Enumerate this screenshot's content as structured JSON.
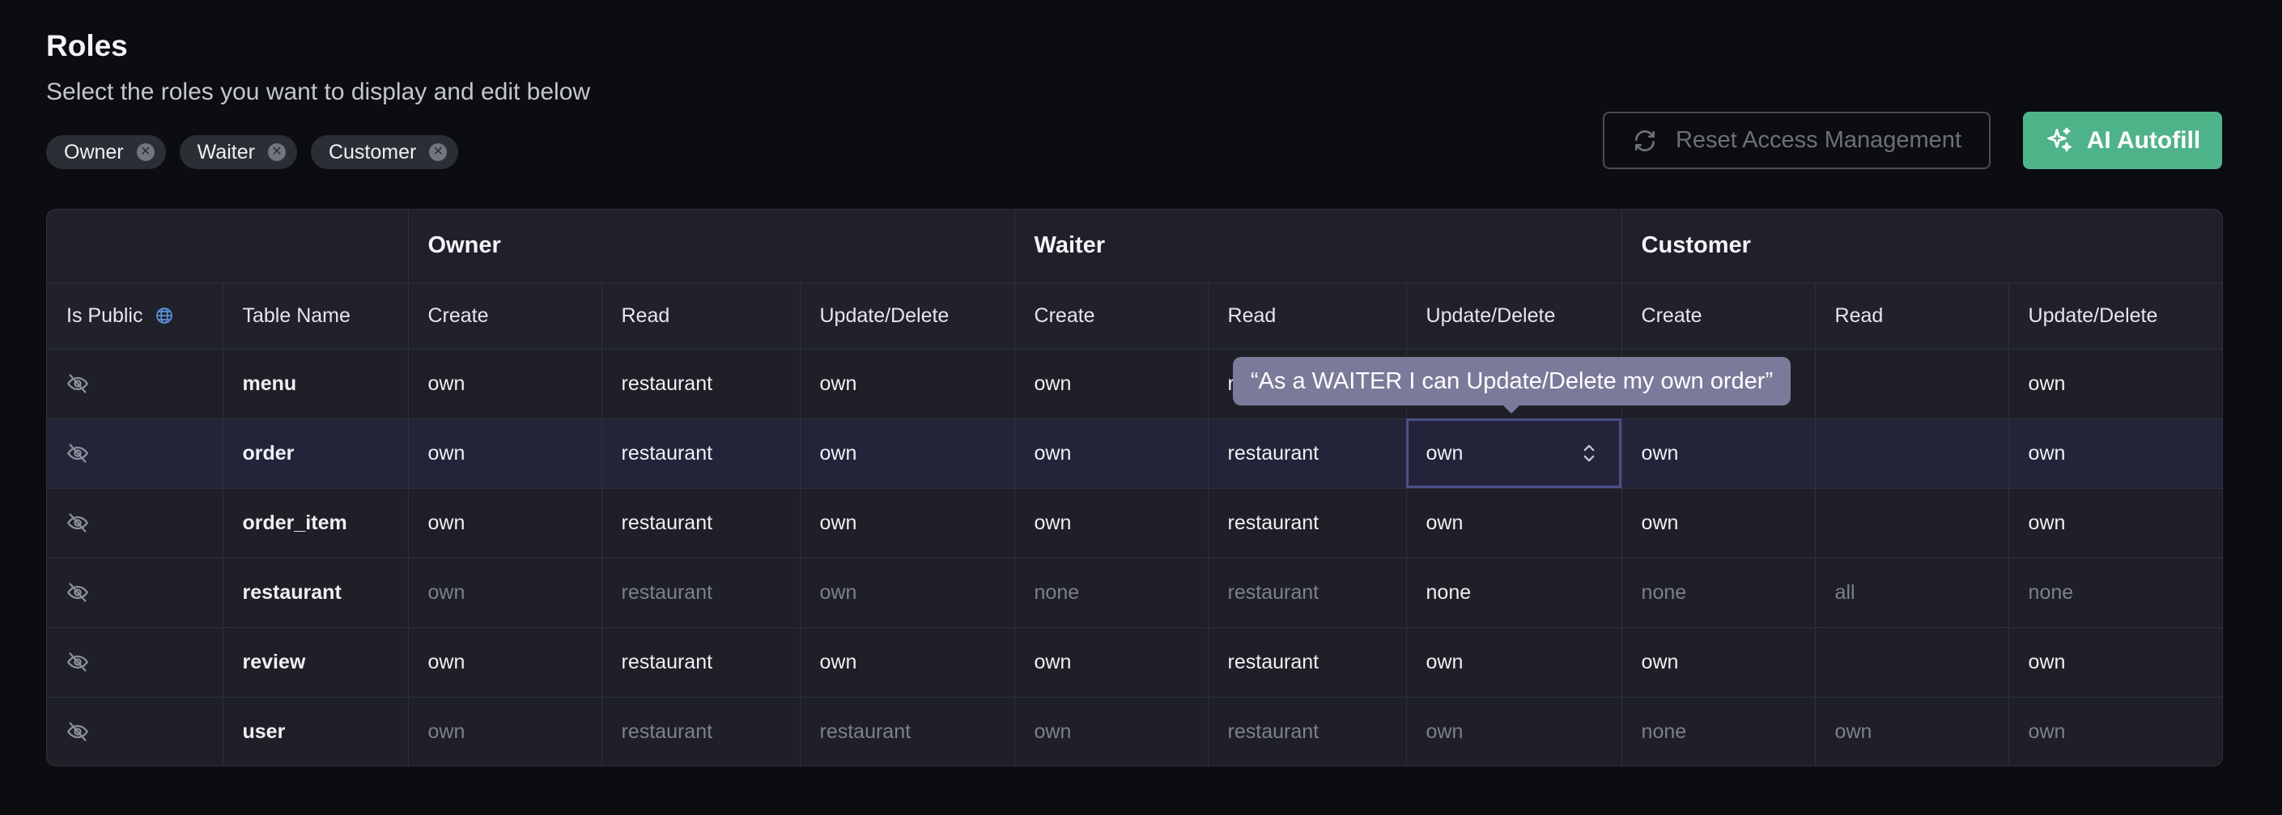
{
  "header": {
    "title": "Roles",
    "subtitle": "Select the roles you want to display and edit below"
  },
  "chips": [
    "Owner",
    "Waiter",
    "Customer"
  ],
  "buttons": {
    "reset_label": "Reset Access Management",
    "ai_label": "AI Autofill"
  },
  "table": {
    "groups": [
      "Owner",
      "Waiter",
      "Customer"
    ],
    "is_public_label": "Is Public",
    "table_name_label": "Table Name",
    "columns": [
      "Create",
      "Read",
      "Update/Delete",
      "Create",
      "Read",
      "Update/Delete",
      "Create",
      "Read",
      "Update/Delete"
    ],
    "rows": [
      {
        "name": "menu",
        "cells": [
          "own",
          "restaurant",
          "own",
          "own",
          "restaurant",
          "",
          "",
          "",
          "own"
        ],
        "muted": [
          false,
          false,
          false,
          false,
          false,
          false,
          false,
          false,
          false
        ]
      },
      {
        "name": "order",
        "cells": [
          "own",
          "restaurant",
          "own",
          "own",
          "restaurant",
          "own",
          "own",
          "",
          "own"
        ],
        "muted": [
          false,
          false,
          false,
          false,
          false,
          false,
          false,
          false,
          false
        ]
      },
      {
        "name": "order_item",
        "cells": [
          "own",
          "restaurant",
          "own",
          "own",
          "restaurant",
          "own",
          "own",
          "",
          "own"
        ],
        "muted": [
          false,
          false,
          false,
          false,
          false,
          false,
          false,
          false,
          false
        ]
      },
      {
        "name": "restaurant",
        "cells": [
          "own",
          "restaurant",
          "own",
          "none",
          "restaurant",
          "none",
          "none",
          "all",
          "none"
        ],
        "muted": [
          true,
          true,
          true,
          true,
          true,
          false,
          true,
          true,
          true
        ]
      },
      {
        "name": "review",
        "cells": [
          "own",
          "restaurant",
          "own",
          "own",
          "restaurant",
          "own",
          "own",
          "",
          "own"
        ],
        "muted": [
          false,
          false,
          false,
          false,
          false,
          false,
          false,
          false,
          false
        ]
      },
      {
        "name": "user",
        "cells": [
          "own",
          "restaurant",
          "restaurant",
          "own",
          "restaurant",
          "own",
          "none",
          "own",
          "own"
        ],
        "muted": [
          true,
          true,
          true,
          true,
          true,
          true,
          true,
          true,
          true
        ]
      }
    ]
  },
  "tooltip": "“As a WAITER I can Update/Delete my own order”",
  "icons": {
    "chip_remove": "close-circle-icon",
    "reset": "refresh-icon",
    "ai": "sparkles-icon",
    "public": "globe-icon",
    "row_public": "eye-off-icon",
    "select": "chevron-up-down-icon"
  },
  "colors": {
    "background": "#0c0d11",
    "accent": "#4fb38a",
    "tooltip": "#7b7a9a",
    "selected_outline": "#4b4f88",
    "globe": "#5b8fd6"
  }
}
